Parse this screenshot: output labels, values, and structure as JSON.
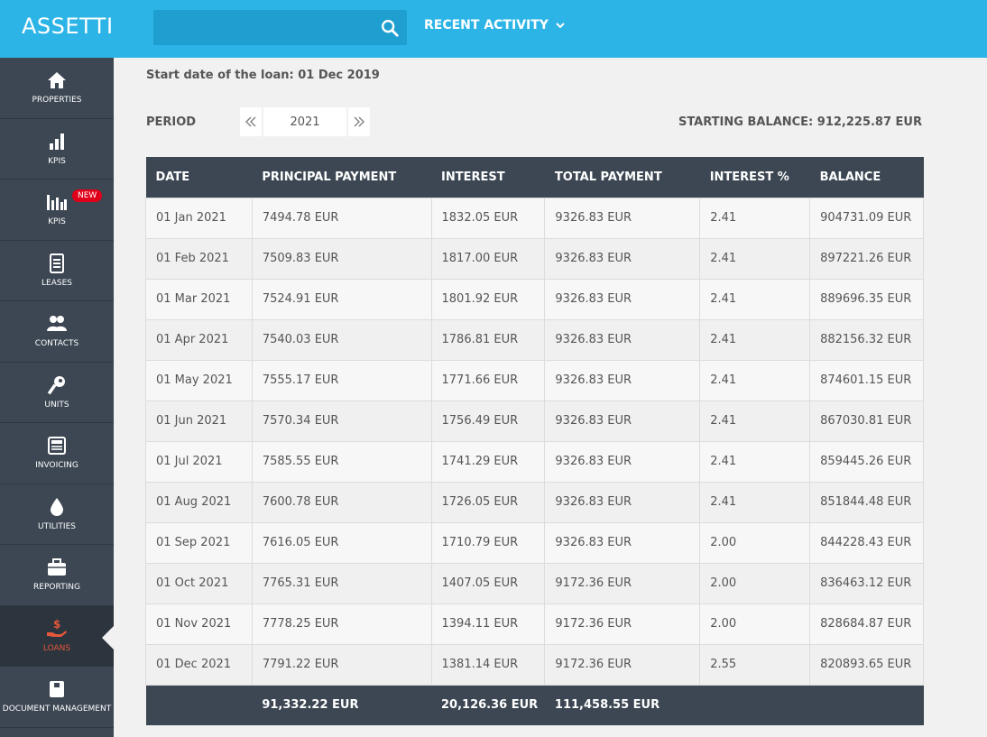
{
  "app": {
    "title": "ASSETTI"
  },
  "header": {
    "search_placeholder": "",
    "recent_activity": "RECENT ACTIVITY"
  },
  "sidebar": {
    "items": [
      {
        "label": "PROPERTIES",
        "icon": "home-icon"
      },
      {
        "label": "KPIS",
        "icon": "bar-chart-icon"
      },
      {
        "label": "KPIS",
        "icon": "bar-chart-group-icon",
        "badge": "NEW"
      },
      {
        "label": "LEASES",
        "icon": "document-icon"
      },
      {
        "label": "CONTACTS",
        "icon": "users-icon"
      },
      {
        "label": "UNITS",
        "icon": "key-icon"
      },
      {
        "label": "INVOICING",
        "icon": "invoice-icon"
      },
      {
        "label": "UTILITIES",
        "icon": "drop-icon"
      },
      {
        "label": "REPORTING",
        "icon": "briefcase-icon"
      },
      {
        "label": "LOANS",
        "icon": "hand-dollar-icon",
        "active": true
      },
      {
        "label": "DOCUMENT MANAGEMENT",
        "icon": "file-box-icon"
      }
    ]
  },
  "loan": {
    "start_date": "Start date of the loan: 01 Dec 2019",
    "period_label": "PERIOD",
    "period_year": "2021",
    "starting_balance": "STARTING BALANCE: 912,225.87 EUR"
  },
  "table": {
    "headers": [
      "DATE",
      "PRINCIPAL PAYMENT",
      "INTEREST",
      "TOTAL PAYMENT",
      "INTEREST %",
      "BALANCE"
    ],
    "rows": [
      [
        "01 Jan 2021",
        "7494.78 EUR",
        "1832.05 EUR",
        "9326.83 EUR",
        "2.41",
        "904731.09 EUR"
      ],
      [
        "01 Feb 2021",
        "7509.83 EUR",
        "1817.00 EUR",
        "9326.83 EUR",
        "2.41",
        "897221.26 EUR"
      ],
      [
        "01 Mar 2021",
        "7524.91 EUR",
        "1801.92 EUR",
        "9326.83 EUR",
        "2.41",
        "889696.35 EUR"
      ],
      [
        "01 Apr 2021",
        "7540.03 EUR",
        "1786.81 EUR",
        "9326.83 EUR",
        "2.41",
        "882156.32 EUR"
      ],
      [
        "01 May 2021",
        "7555.17 EUR",
        "1771.66 EUR",
        "9326.83 EUR",
        "2.41",
        "874601.15 EUR"
      ],
      [
        "01 Jun 2021",
        "7570.34 EUR",
        "1756.49 EUR",
        "9326.83 EUR",
        "2.41",
        "867030.81 EUR"
      ],
      [
        "01 Jul 2021",
        "7585.55 EUR",
        "1741.29 EUR",
        "9326.83 EUR",
        "2.41",
        "859445.26 EUR"
      ],
      [
        "01 Aug 2021",
        "7600.78 EUR",
        "1726.05 EUR",
        "9326.83 EUR",
        "2.41",
        "851844.48 EUR"
      ],
      [
        "01 Sep 2021",
        "7616.05 EUR",
        "1710.79 EUR",
        "9326.83 EUR",
        "2.00",
        "844228.43 EUR"
      ],
      [
        "01 Oct 2021",
        "7765.31 EUR",
        "1407.05 EUR",
        "9172.36 EUR",
        "2.00",
        "836463.12 EUR"
      ],
      [
        "01 Nov 2021",
        "7778.25 EUR",
        "1394.11 EUR",
        "9172.36 EUR",
        "2.00",
        "828684.87 EUR"
      ],
      [
        "01 Dec 2021",
        "7791.22 EUR",
        "1381.14 EUR",
        "9172.36 EUR",
        "2.55",
        "820893.65 EUR"
      ]
    ],
    "totals": [
      "",
      "91,332.22 EUR",
      "20,126.36 EUR",
      "111,458.55 EUR",
      "",
      ""
    ]
  },
  "colors": {
    "topbar": "#2db4e6",
    "sidebar": "#3c4753",
    "active": "#e5573a",
    "badge": "#e1001a"
  }
}
